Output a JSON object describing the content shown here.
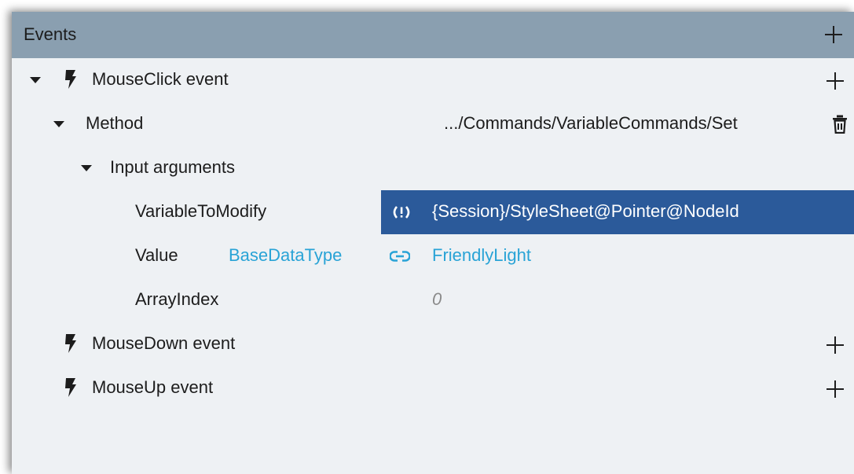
{
  "header": {
    "title": "Events",
    "add_icon": "plus-icon"
  },
  "tree": {
    "mouse_click": {
      "label": "MouseClick event",
      "expanded": true,
      "icon": "lightning-bolt-icon"
    },
    "method": {
      "label": "Method",
      "value": ".../Commands/VariableCommands/Set",
      "delete_icon": "trash-icon"
    },
    "input_arguments": {
      "label": "Input arguments"
    },
    "variable_to_modify": {
      "label": "VariableToModify",
      "value": "{Session}/StyleSheet@Pointer@NodeId",
      "icon": "dynamic-link-warning-icon",
      "selected": true
    },
    "value_arg": {
      "label": "Value",
      "type": "BaseDataType",
      "value": "FriendlyLight",
      "icon": "link-icon"
    },
    "array_index": {
      "label": "ArrayIndex",
      "value": "0"
    },
    "mouse_down": {
      "label": "MouseDown event",
      "icon": "lightning-bolt-icon"
    },
    "mouse_up": {
      "label": "MouseUp event",
      "icon": "lightning-bolt-icon"
    }
  },
  "colors": {
    "header_bg": "#8a9fb0",
    "panel_bg": "#eef1f4",
    "selected_bg": "#2b5a9a",
    "link": "#29a3d6"
  }
}
